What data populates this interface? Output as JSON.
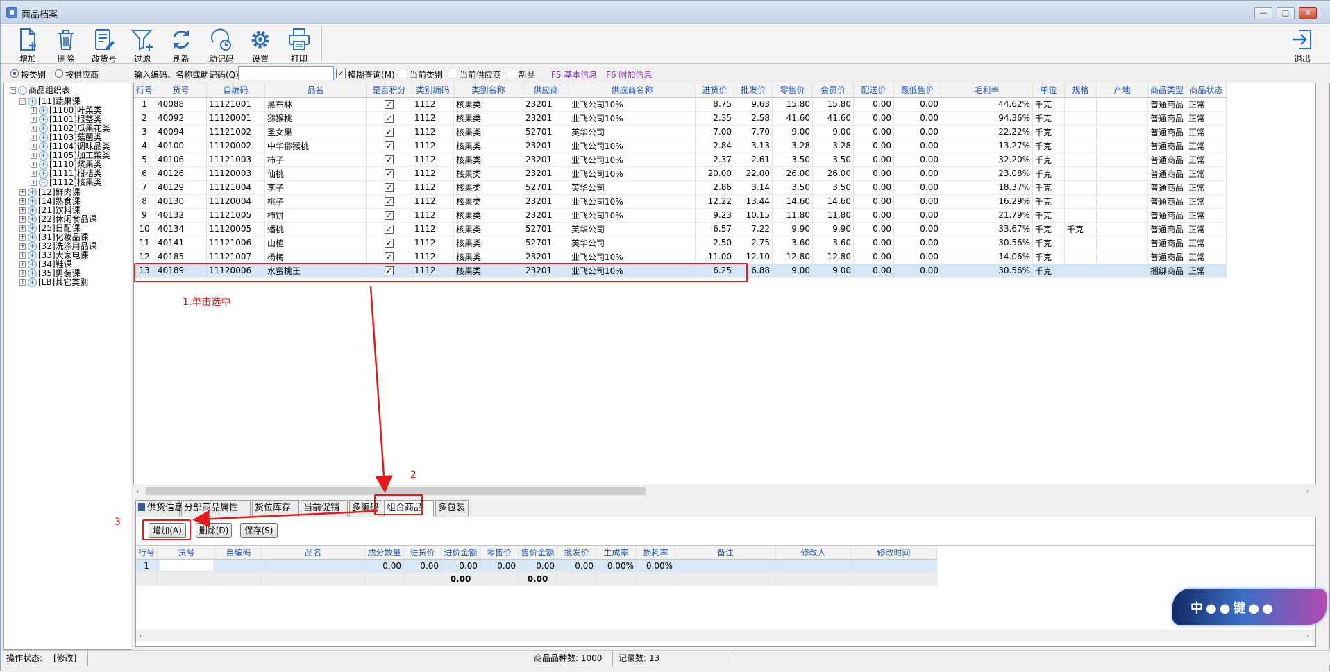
{
  "window": {
    "title": "商品档案"
  },
  "toolbar": {
    "items": [
      {
        "label": "增加",
        "icon": "add-doc-icon"
      },
      {
        "label": "删除",
        "icon": "trash-icon"
      },
      {
        "label": "改货号",
        "icon": "edit-doc-icon"
      },
      {
        "label": "过滤",
        "icon": "filter-icon"
      },
      {
        "label": "刷新",
        "icon": "refresh-icon"
      },
      {
        "label": "助记码",
        "icon": "memo-icon"
      },
      {
        "label": "设置",
        "icon": "gear-icon"
      },
      {
        "label": "打印",
        "icon": "printer-icon"
      }
    ],
    "exit_label": "退出"
  },
  "filter": {
    "by_category": "按类别",
    "by_supplier": "按供应商",
    "search_label": "输入编码、名称或助记码(Q)",
    "fuzzy": "模糊查询(M)",
    "current_category": "当前类别",
    "current_supplier": "当前供应商",
    "new_item": "新品",
    "f5": "F5 基本信息",
    "f6": "F6 附加信息"
  },
  "tree": {
    "root": "商品组织表",
    "nodes": [
      {
        "label": "[11]蔬果课",
        "level": 1,
        "expander": "-"
      },
      {
        "label": "[1100]叶菜类",
        "level": 2,
        "expander": "+"
      },
      {
        "label": "[1101]根茎类",
        "level": 2,
        "expander": "+"
      },
      {
        "label": "[1102]瓜果花类",
        "level": 2,
        "expander": "+"
      },
      {
        "label": "[1103]菇菌类",
        "level": 2,
        "expander": "+"
      },
      {
        "label": "[1104]调味品类",
        "level": 2,
        "expander": "+"
      },
      {
        "label": "[1105]加工菜类",
        "level": 2,
        "expander": "+"
      },
      {
        "label": "[1110]浆果类",
        "level": 2,
        "expander": "+"
      },
      {
        "label": "[1111]柑桔类",
        "level": 2,
        "expander": "+"
      },
      {
        "label": "[1112]核果类",
        "level": 2,
        "expander": "+"
      },
      {
        "label": "[12]鲜肉课",
        "level": 1,
        "expander": "+"
      },
      {
        "label": "[14]熟食课",
        "level": 1,
        "expander": "+"
      },
      {
        "label": "[21]饮料课",
        "level": 1,
        "expander": "+"
      },
      {
        "label": "[22]休闲食品课",
        "level": 1,
        "expander": "+"
      },
      {
        "label": "[25]日配课",
        "level": 1,
        "expander": "+"
      },
      {
        "label": "[31]化妆品课",
        "level": 1,
        "expander": "+"
      },
      {
        "label": "[32]洗涤用品课",
        "level": 1,
        "expander": "+"
      },
      {
        "label": "[33]大家电课",
        "level": 1,
        "expander": "+"
      },
      {
        "label": "[34]鞋课",
        "level": 1,
        "expander": "+"
      },
      {
        "label": "[35]男装课",
        "level": 1,
        "expander": "+"
      },
      {
        "label": "[LB]其它类别",
        "level": 1,
        "expander": "+"
      }
    ]
  },
  "grid": {
    "columns": [
      "行号",
      "货号",
      "自编码",
      "品名",
      "是否积分",
      "类别编码",
      "类别名称",
      "供应商",
      "供应商名称",
      "进货价",
      "批发价",
      "零售价",
      "会员价",
      "配送价",
      "最低售价",
      "毛利率",
      "单位",
      "规格",
      "产地",
      "商品类型",
      "商品状态"
    ],
    "rows": [
      [
        "1",
        "40088",
        "11121001",
        "黑布林",
        "✓",
        "1112",
        "核果类",
        "23201",
        "业飞公司10%",
        "8.75",
        "9.63",
        "15.80",
        "15.80",
        "0.00",
        "0.00",
        "44.62%",
        "千克",
        "",
        "",
        "普通商品",
        "正常"
      ],
      [
        "2",
        "40092",
        "11120001",
        "猕猴桃",
        "✓",
        "1112",
        "核果类",
        "23201",
        "业飞公司10%",
        "2.35",
        "2.58",
        "41.60",
        "41.60",
        "0.00",
        "0.00",
        "94.36%",
        "千克",
        "",
        "",
        "普通商品",
        "正常"
      ],
      [
        "3",
        "40094",
        "11121002",
        "圣女果",
        "✓",
        "1112",
        "核果类",
        "52701",
        "英华公司",
        "7.00",
        "7.70",
        "9.00",
        "9.00",
        "0.00",
        "0.00",
        "22.22%",
        "千克",
        "",
        "",
        "普通商品",
        "正常"
      ],
      [
        "4",
        "40100",
        "11120002",
        "中华猕猴桃",
        "✓",
        "1112",
        "核果类",
        "23201",
        "业飞公司10%",
        "2.84",
        "3.13",
        "3.28",
        "3.28",
        "0.00",
        "0.00",
        "13.27%",
        "千克",
        "",
        "",
        "普通商品",
        "正常"
      ],
      [
        "5",
        "40106",
        "11121003",
        "柿子",
        "✓",
        "1112",
        "核果类",
        "23201",
        "业飞公司10%",
        "2.37",
        "2.61",
        "3.50",
        "3.50",
        "0.00",
        "0.00",
        "32.20%",
        "千克",
        "",
        "",
        "普通商品",
        "正常"
      ],
      [
        "6",
        "40126",
        "11120003",
        "仙桃",
        "✓",
        "1112",
        "核果类",
        "23201",
        "业飞公司10%",
        "20.00",
        "22.00",
        "26.00",
        "26.00",
        "0.00",
        "0.00",
        "23.08%",
        "千克",
        "",
        "",
        "普通商品",
        "正常"
      ],
      [
        "7",
        "40129",
        "11121004",
        "李子",
        "✓",
        "1112",
        "核果类",
        "52701",
        "英华公司",
        "2.86",
        "3.14",
        "3.50",
        "3.50",
        "0.00",
        "0.00",
        "18.37%",
        "千克",
        "",
        "",
        "普通商品",
        "正常"
      ],
      [
        "8",
        "40130",
        "11120004",
        "桃子",
        "✓",
        "1112",
        "核果类",
        "23201",
        "业飞公司10%",
        "12.22",
        "13.44",
        "14.60",
        "14.60",
        "0.00",
        "0.00",
        "16.29%",
        "千克",
        "",
        "",
        "普通商品",
        "正常"
      ],
      [
        "9",
        "40132",
        "11121005",
        "柿饼",
        "✓",
        "1112",
        "核果类",
        "23201",
        "业飞公司10%",
        "9.23",
        "10.15",
        "11.80",
        "11.80",
        "0.00",
        "0.00",
        "21.79%",
        "千克",
        "",
        "",
        "普通商品",
        "正常"
      ],
      [
        "10",
        "40134",
        "11120005",
        "蟠桃",
        "✓",
        "1112",
        "核果类",
        "52701",
        "英华公司",
        "6.57",
        "7.22",
        "9.90",
        "9.90",
        "0.00",
        "0.00",
        "33.67%",
        "千克",
        "千克",
        "",
        "普通商品",
        "正常"
      ],
      [
        "11",
        "40141",
        "11121006",
        "山楂",
        "✓",
        "1112",
        "核果类",
        "52701",
        "英华公司",
        "2.50",
        "2.75",
        "3.60",
        "3.60",
        "0.00",
        "0.00",
        "30.56%",
        "千克",
        "",
        "",
        "普通商品",
        "正常"
      ],
      [
        "12",
        "40185",
        "11121007",
        "杨梅",
        "✓",
        "1112",
        "核果类",
        "23201",
        "业飞公司10%",
        "11.00",
        "12.10",
        "12.80",
        "12.80",
        "0.00",
        "0.00",
        "14.06%",
        "千克",
        "",
        "",
        "普通商品",
        "正常"
      ],
      [
        "13",
        "40189",
        "11120006",
        "水蜜桃王",
        "✓",
        "1112",
        "核果类",
        "23201",
        "业飞公司10%",
        "6.25",
        "6.88",
        "9.00",
        "9.00",
        "0.00",
        "0.00",
        "30.56%",
        "千克",
        "",
        "",
        "捆绑商品",
        "正常"
      ]
    ],
    "selected_row": 13
  },
  "tabs": [
    "供货信息",
    "分部商品属性",
    "货位库存",
    "当前促销",
    "多编码",
    "组合商品",
    "多包装"
  ],
  "active_tab": "组合商品",
  "subpanel": {
    "add": "增加(A)",
    "delete": "删除(D)",
    "save": "保存(S)",
    "columns": [
      "行号",
      "货号",
      "自编码",
      "品名",
      "成分数量",
      "进货价",
      "进价金额",
      "零售价",
      "售价金额",
      "批发价",
      "生成率",
      "损耗率",
      "备注",
      "修改人",
      "修改时间"
    ],
    "row": [
      "1",
      "",
      "",
      "",
      "0.00",
      "0.00",
      "0.00",
      "0.00",
      "0.00",
      "0.00",
      "0.00%",
      "0.00%",
      "",
      "",
      ""
    ],
    "sum": [
      "",
      "",
      "",
      "",
      "",
      "",
      "0.00",
      "",
      "0.00",
      "",
      "",
      "",
      "",
      "",
      ""
    ]
  },
  "status": {
    "op_label": "操作状态:",
    "op_value": "[修改]",
    "count_label": "商品品种数: 1000",
    "records_label": "记录数: 13"
  },
  "annotations": {
    "step1": "1.单击选中",
    "step2": "2",
    "step3": "3"
  },
  "logo_text": "中●●键●●"
}
